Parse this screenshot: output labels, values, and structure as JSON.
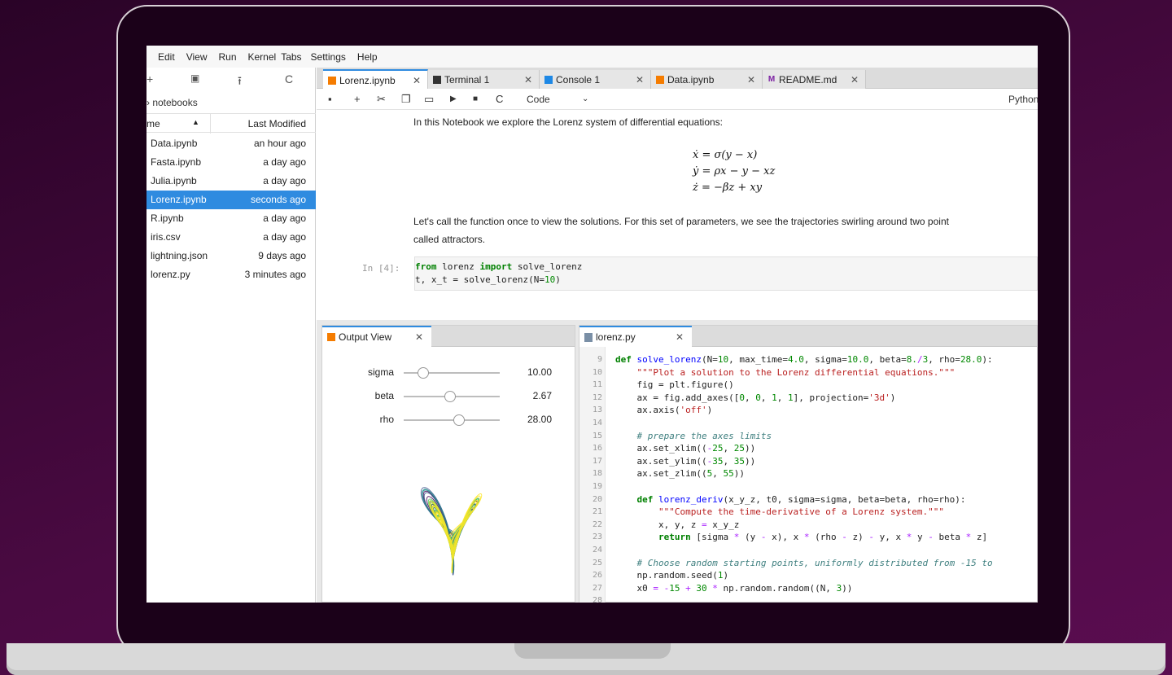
{
  "menu": [
    "Edit",
    "View",
    "Run",
    "Kernel",
    "Tabs",
    "Settings",
    "Help"
  ],
  "file_browser": {
    "toolbar": [
      "+",
      "▣",
      "⭱",
      "C"
    ],
    "breadcrumb": "› notebooks",
    "col_name": "me",
    "col_modified": "Last Modified",
    "files": [
      {
        "name": "Data.ipynb",
        "modified": "an hour ago"
      },
      {
        "name": "Fasta.ipynb",
        "modified": "a day ago"
      },
      {
        "name": "Julia.ipynb",
        "modified": "a day ago"
      },
      {
        "name": "Lorenz.ipynb",
        "modified": "seconds ago"
      },
      {
        "name": "R.ipynb",
        "modified": "a day ago"
      },
      {
        "name": "iris.csv",
        "modified": "a day ago"
      },
      {
        "name": "lightning.json",
        "modified": "9 days ago"
      },
      {
        "name": "lorenz.py",
        "modified": "3 minutes ago"
      }
    ]
  },
  "tabs": [
    {
      "label": "Lorenz.ipynb",
      "active": true
    },
    {
      "label": "Terminal 1"
    },
    {
      "label": "Console 1"
    },
    {
      "label": "Data.ipynb"
    },
    {
      "label": "README.md"
    }
  ],
  "notebook_toolbar": {
    "cell_type": "Code",
    "kernel": "Python"
  },
  "notebook": {
    "intro": "In this Notebook we explore the Lorenz system of differential equations:",
    "equations": [
      "ẋ = σ(y − x)",
      "ẏ = ρx − y − xz",
      "ż = −βz + xy"
    ],
    "text_line1": "Let's call the function once to view the solutions. For this set of parameters, we see the trajectories swirling around two point",
    "text_line2": "called attractors.",
    "prompt": "In [4]:",
    "code": [
      {
        "parts": [
          [
            "kw",
            "from"
          ],
          [
            "",
            " lorenz "
          ],
          [
            "kw",
            "import"
          ],
          [
            "",
            " solve_lorenz"
          ]
        ]
      },
      {
        "parts": [
          [
            "",
            "t, x_t = solve_lorenz(N="
          ],
          [
            "num",
            "10"
          ],
          [
            "",
            ")"
          ]
        ]
      }
    ]
  },
  "output_view": {
    "title": "Output View",
    "sliders": [
      {
        "label": "sigma",
        "value": "10.00",
        "level": 0.2
      },
      {
        "label": "beta",
        "value": "2.67",
        "level": 0.48
      },
      {
        "label": "rho",
        "value": "28.00",
        "level": 0.58
      }
    ],
    "attractor_colors": [
      "#440154",
      "#3b528b",
      "#21908d",
      "#5dc863",
      "#fde725"
    ]
  },
  "editor": {
    "title": "lorenz.py",
    "lines": [
      {
        "n": "9",
        "parts": [
          [
            "kw",
            "def"
          ],
          [
            "",
            " "
          ],
          [
            "fn",
            "solve_lorenz"
          ],
          [
            "",
            "(N="
          ],
          [
            "num",
            "10"
          ],
          [
            "",
            ", max_time="
          ],
          [
            "num",
            "4.0"
          ],
          [
            "",
            ", sigma="
          ],
          [
            "num",
            "10.0"
          ],
          [
            "",
            ", beta="
          ],
          [
            "num",
            "8."
          ],
          [
            "op",
            "/"
          ],
          [
            "num",
            "3"
          ],
          [
            "",
            ", rho="
          ],
          [
            "num",
            "28.0"
          ],
          [
            "",
            "):"
          ]
        ]
      },
      {
        "n": "10",
        "parts": [
          [
            "",
            "    "
          ],
          [
            "str",
            "\"\"\"Plot a solution to the Lorenz differential equations.\"\"\""
          ]
        ]
      },
      {
        "n": "11",
        "parts": [
          [
            "",
            "    fig = plt.figure()"
          ]
        ]
      },
      {
        "n": "12",
        "parts": [
          [
            "",
            "    ax = fig.add_axes(["
          ],
          [
            "num",
            "0"
          ],
          [
            "",
            ", "
          ],
          [
            "num",
            "0"
          ],
          [
            "",
            ", "
          ],
          [
            "num",
            "1"
          ],
          [
            "",
            ", "
          ],
          [
            "num",
            "1"
          ],
          [
            "",
            "], projection="
          ],
          [
            "str",
            "'3d'"
          ],
          [
            "",
            ")"
          ]
        ]
      },
      {
        "n": "13",
        "parts": [
          [
            "",
            "    ax.axis("
          ],
          [
            "str",
            "'off'"
          ],
          [
            "",
            ")"
          ]
        ]
      },
      {
        "n": "14",
        "parts": [
          [
            "",
            ""
          ]
        ]
      },
      {
        "n": "15",
        "parts": [
          [
            "",
            "    "
          ],
          [
            "com",
            "# prepare the axes limits"
          ]
        ]
      },
      {
        "n": "16",
        "parts": [
          [
            "",
            "    ax.set_xlim(("
          ],
          [
            "op",
            "-"
          ],
          [
            "num",
            "25"
          ],
          [
            "",
            ", "
          ],
          [
            "num",
            "25"
          ],
          [
            "",
            "))"
          ]
        ]
      },
      {
        "n": "17",
        "parts": [
          [
            "",
            "    ax.set_ylim(("
          ],
          [
            "op",
            "-"
          ],
          [
            "num",
            "35"
          ],
          [
            "",
            ", "
          ],
          [
            "num",
            "35"
          ],
          [
            "",
            "))"
          ]
        ]
      },
      {
        "n": "18",
        "parts": [
          [
            "",
            "    ax.set_zlim(("
          ],
          [
            "num",
            "5"
          ],
          [
            "",
            ", "
          ],
          [
            "num",
            "55"
          ],
          [
            "",
            "))"
          ]
        ]
      },
      {
        "n": "19",
        "parts": [
          [
            "",
            ""
          ]
        ]
      },
      {
        "n": "20",
        "parts": [
          [
            "",
            "    "
          ],
          [
            "kw",
            "def"
          ],
          [
            "",
            " "
          ],
          [
            "fn",
            "lorenz_deriv"
          ],
          [
            "",
            "(x_y_z, t0, sigma=sigma, beta=beta, rho=rho):"
          ]
        ]
      },
      {
        "n": "21",
        "parts": [
          [
            "",
            "        "
          ],
          [
            "str",
            "\"\"\"Compute the time-derivative of a Lorenz system.\"\"\""
          ]
        ]
      },
      {
        "n": "22",
        "parts": [
          [
            "",
            "        x, y, z "
          ],
          [
            "op",
            "="
          ],
          [
            "",
            " x_y_z"
          ]
        ]
      },
      {
        "n": "23",
        "parts": [
          [
            "",
            "        "
          ],
          [
            "kw",
            "return"
          ],
          [
            "",
            " [sigma "
          ],
          [
            "op",
            "*"
          ],
          [
            "",
            " (y "
          ],
          [
            "op",
            "-"
          ],
          [
            "",
            " x), x "
          ],
          [
            "op",
            "*"
          ],
          [
            "",
            " (rho "
          ],
          [
            "op",
            "-"
          ],
          [
            "",
            " z) "
          ],
          [
            "op",
            "-"
          ],
          [
            "",
            " y, x "
          ],
          [
            "op",
            "*"
          ],
          [
            "",
            " y "
          ],
          [
            "op",
            "-"
          ],
          [
            "",
            " beta "
          ],
          [
            "op",
            "*"
          ],
          [
            "",
            " z]"
          ]
        ]
      },
      {
        "n": "24",
        "parts": [
          [
            "",
            ""
          ]
        ]
      },
      {
        "n": "25",
        "parts": [
          [
            "",
            "    "
          ],
          [
            "com",
            "# Choose random starting points, uniformly distributed from -15 to"
          ]
        ]
      },
      {
        "n": "26",
        "parts": [
          [
            "",
            "    np.random.seed("
          ],
          [
            "num",
            "1"
          ],
          [
            "",
            ")"
          ]
        ]
      },
      {
        "n": "27",
        "parts": [
          [
            "",
            "    x0 "
          ],
          [
            "op",
            "="
          ],
          [
            "",
            " "
          ],
          [
            "op",
            "-"
          ],
          [
            "num",
            "15"
          ],
          [
            "",
            " "
          ],
          [
            "op",
            "+"
          ],
          [
            "",
            " "
          ],
          [
            "num",
            "30"
          ],
          [
            "",
            " "
          ],
          [
            "op",
            "*"
          ],
          [
            "",
            " np.random.random((N, "
          ],
          [
            "num",
            "3"
          ],
          [
            "",
            "))"
          ]
        ]
      },
      {
        "n": "28",
        "parts": [
          [
            "",
            ""
          ]
        ]
      }
    ]
  }
}
